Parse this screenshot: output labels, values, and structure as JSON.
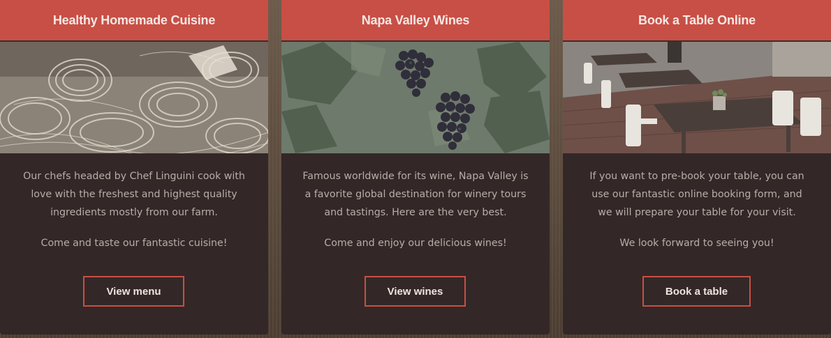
{
  "cards": [
    {
      "title": "Healthy Homemade Cuisine",
      "image_alt": "pasta",
      "description": "Our chefs headed by Chef Linguini cook with love with the freshest and highest quality ingredients mostly from our farm.",
      "tagline": "Come and taste our fantastic cuisine!",
      "button_label": "View menu"
    },
    {
      "title": "Napa Valley Wines",
      "image_alt": "grapes",
      "description": "Famous worldwide for its wine, Napa Valley is a favorite global destination for winery tours and tastings. Here are the very best.",
      "tagline": "Come and enjoy our delicious wines!",
      "button_label": "View wines"
    },
    {
      "title": "Book a Table Online",
      "image_alt": "restaurant terrace",
      "description": "If you want to pre-book your table, you can use our fantastic online booking form, and we will prepare your table for your visit.",
      "tagline": "We look forward to seeing you!",
      "button_label": "Book a table"
    }
  ],
  "colors": {
    "accent": "#c84f45",
    "card_bg": "#332827",
    "text": "#b9aca8"
  }
}
